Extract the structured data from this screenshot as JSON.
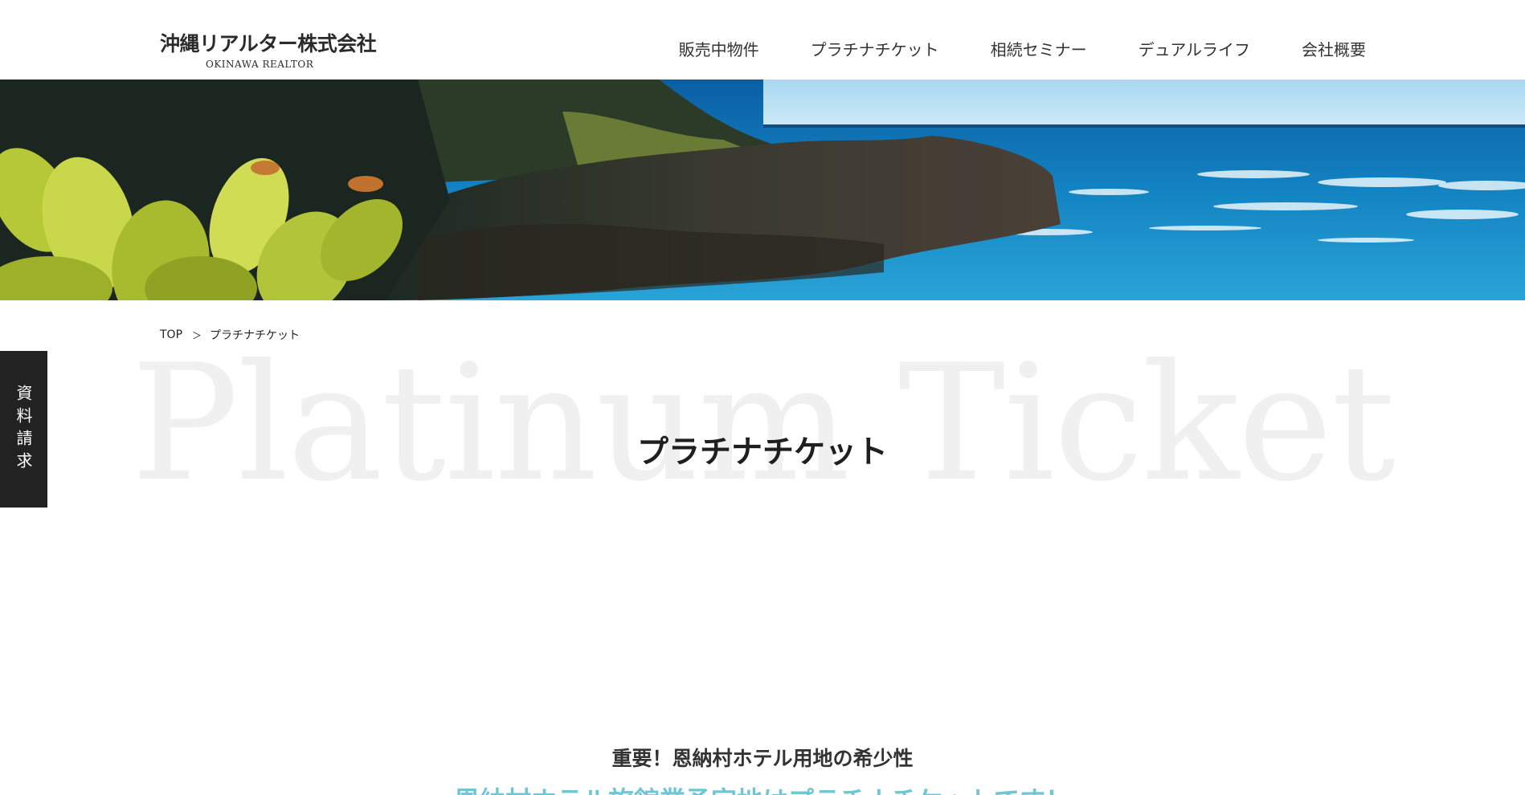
{
  "header": {
    "logo_ja": "沖縄リアルター株式会社",
    "logo_en": "OKINAWA REALTOR",
    "nav": [
      {
        "label": "販売中物件"
      },
      {
        "label": "プラチナチケット"
      },
      {
        "label": "相続セミナー"
      },
      {
        "label": "デュアルライフ"
      },
      {
        "label": "会社概要"
      }
    ]
  },
  "breadcrumb": {
    "home": "TOP",
    "separator": "＞",
    "current": "プラチナチケット"
  },
  "side_tab": {
    "label": "資料請求"
  },
  "title": {
    "background_text": "Platinum Ticket",
    "main": "プラチナチケット"
  },
  "section": {
    "subheading": "重要！恩納村ホテル用地の希少性",
    "lead": "恩納村ホテル旅館業予定地はプラチナチケットです！"
  },
  "colors": {
    "side_tab_bg": "#222222",
    "lead_text": "#6fc6d6",
    "background_text": "#f0f0f0"
  }
}
